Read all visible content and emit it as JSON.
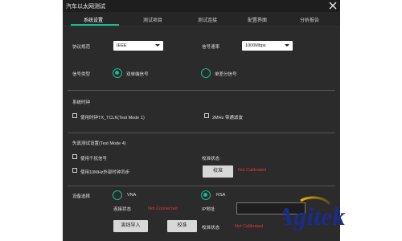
{
  "window": {
    "title": "汽车以太网测试"
  },
  "tabs": [
    {
      "label": "系统设置"
    },
    {
      "label": "测试项目"
    },
    {
      "label": "测试连接"
    },
    {
      "label": "配置界面"
    },
    {
      "label": "分析报告"
    }
  ],
  "protocol": {
    "label": "协议规范",
    "value": "IEEE"
  },
  "rate": {
    "label": "信号速率",
    "value": "1000Mbps"
  },
  "signal_type": {
    "label": "信号类型",
    "option1": "双单端信号",
    "option2": "单差分信号",
    "selected": "双单端信号"
  },
  "system_clock": {
    "title": "系统时钟",
    "opt_tx_tclk": "使用时钟TX_TCLK(Test Mode 1)",
    "opt_2mhz": "2MHz 带通滤波"
  },
  "distortion": {
    "title": "失真测试设置(Test Mode 4)",
    "opt_interference": "使用干扰信号",
    "opt_10mhz": "使用10MHz外部时钟同步",
    "calib_status_label": "校准状态",
    "calib_status_value": "Not Calibrated",
    "calibrate_button": "校准"
  },
  "device": {
    "title": "设备选择",
    "vna": "VNA",
    "rsa": "RSA",
    "selected": "RSA",
    "conn_status_label": "连接状态",
    "conn_status_value": "Not Connected",
    "ip_label": "IP地址",
    "ip_value": "",
    "offline_import_button": "离线导入",
    "calibrate_button": "校准",
    "calib_status_label": "校准状态",
    "calib_status_value": "Not Calibrated"
  },
  "brand": {
    "text": "Agitek",
    "color": "#1a2c8c"
  },
  "colors": {
    "accent": "#1aba8f",
    "status_red": "#e23b3b"
  },
  "icons": {
    "close": "close-icon"
  }
}
